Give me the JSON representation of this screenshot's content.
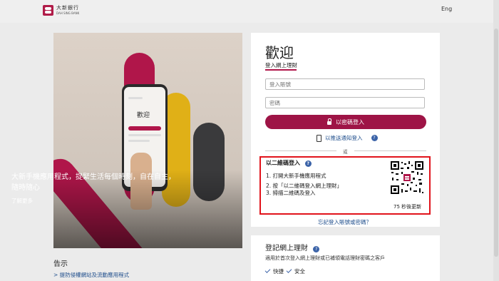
{
  "header": {
    "bank_name_cn": "大新銀行",
    "bank_name_en": "DAH SING BANK",
    "language_toggle": "Eng"
  },
  "promo": {
    "phone_screen_title": "歡迎",
    "text": "大新手機應用程式，捉緊生活每個時刻，自在自主，隨時隨心",
    "link": "了解更多"
  },
  "notice": {
    "title": "告示",
    "items": [
      {
        "label": "提防侵權網站及流動應用程式"
      }
    ]
  },
  "login": {
    "title": "歡迎",
    "subtitle": "登入網上理財",
    "username_placeholder": "登入賬號",
    "password_placeholder": "密碼",
    "password_login_button": "以密碼登入",
    "push_login_link": "以推送通知登入",
    "or_text": "或",
    "forgot_link": "忘記登入賬號或密碼？"
  },
  "qr_login": {
    "title": "以二維碼登入",
    "steps": [
      "1. 打開大新手機應用程式",
      "2. 按「以二維碼登入網上理財」",
      "3. 掃描二維碼及登入"
    ],
    "refresh_text": "75 秒後更新"
  },
  "register": {
    "title": "登記網上理財",
    "description": "適用於首次登入網上理財或已補領電話理財密碼之客戶",
    "features": [
      "快捷",
      "安全"
    ]
  },
  "colors": {
    "brand": "#9e1446",
    "link": "#1f4e8c",
    "highlight_border": "#e1131b"
  }
}
